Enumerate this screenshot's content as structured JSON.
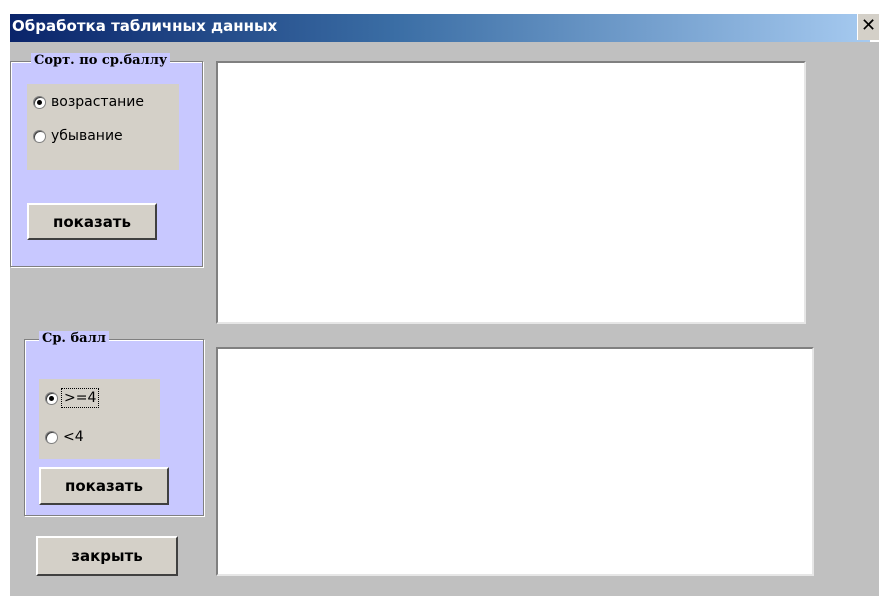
{
  "window": {
    "title": "Обработка табличных данных",
    "close_glyph": "✕"
  },
  "sort_frame": {
    "legend": "Сорт. по ср.баллу",
    "options": [
      {
        "label": "возрастание",
        "checked": true
      },
      {
        "label": "убывание",
        "checked": false
      }
    ],
    "show_button": "показать"
  },
  "avg_frame": {
    "legend": "Ср. балл",
    "options": [
      {
        "label": ">=4",
        "checked": true
      },
      {
        "label": "<4",
        "checked": false
      }
    ],
    "show_button": "показать"
  },
  "close_button": "закрыть",
  "colors": {
    "frame_bg": "#c8c8ff",
    "client_bg": "#c0c0c0",
    "title_start": "#0a246a",
    "title_end": "#a6caf0"
  }
}
